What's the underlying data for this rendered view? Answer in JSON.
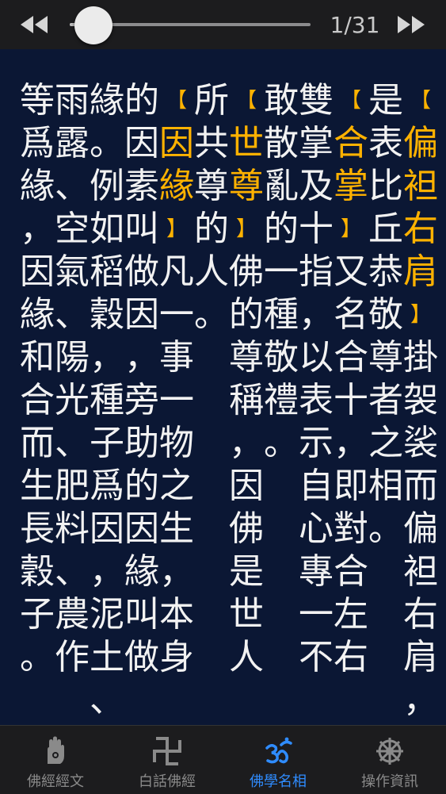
{
  "player": {
    "page_indicator": "1/31",
    "progress": 0.1
  },
  "content": {
    "columns": [
      {
        "chars": [
          "【",
          "偏",
          "袒",
          "右",
          "肩",
          "】",
          "掛",
          "袈",
          "裟",
          "而",
          "偏",
          "袒",
          "右",
          "肩",
          "，"
        ],
        "hl": [
          0,
          1,
          2,
          3,
          4,
          5
        ]
      },
      {
        "chars": [
          "是",
          "表",
          "比",
          "丘",
          "恭",
          "敬",
          "尊",
          "者",
          "之",
          "相",
          "。"
        ],
        "hl": []
      },
      {
        "chars": [
          "【",
          "合",
          "掌",
          "】",
          "又",
          "名",
          "合",
          "十",
          "，",
          "即",
          "對",
          "合",
          "左",
          "右"
        ],
        "hl": [
          0,
          1,
          2,
          3
        ]
      },
      {
        "chars": [
          "雙",
          "掌",
          "及",
          "十",
          "指",
          "，",
          "以",
          "表",
          "示",
          "自",
          "心",
          "專",
          "一",
          "不"
        ],
        "hl": []
      },
      {
        "chars": [
          "敢",
          "散",
          "亂",
          "的",
          "一",
          "種",
          "敬",
          "禮",
          "。"
        ],
        "hl": []
      },
      {
        "chars": [
          "【",
          "世",
          "尊",
          "】",
          "佛",
          "的",
          "尊",
          "稱",
          "，",
          "因",
          "佛",
          "是",
          "世",
          "人"
        ],
        "hl": [
          0,
          1,
          2,
          3
        ]
      },
      {
        "chars": [
          "所",
          "共",
          "尊",
          "的",
          "人",
          "。"
        ],
        "hl": []
      },
      {
        "chars": [
          "【",
          "因",
          "緣",
          "】",
          "凡",
          "一",
          "事",
          "一",
          "物",
          "之",
          "生",
          "，",
          "本",
          "身"
        ],
        "hl": [
          0,
          1,
          2,
          3
        ]
      },
      {
        "chars": [
          "的",
          "因",
          "素",
          "叫",
          "做",
          "因",
          "，",
          "旁",
          "助",
          "的",
          "因",
          "緣",
          "叫",
          "做"
        ],
        "hl": []
      },
      {
        "chars": [
          "緣",
          "。",
          "例",
          "如",
          "稻",
          "穀",
          "，",
          "種",
          "子",
          "爲",
          "因",
          "，",
          "泥",
          "土",
          "、"
        ],
        "hl": []
      },
      {
        "chars": [
          "雨",
          "露",
          "、",
          "空",
          "氣",
          "、",
          "陽",
          "光",
          "、",
          "肥",
          "料",
          "、",
          "農",
          "作"
        ],
        "hl": []
      },
      {
        "chars": [
          "等",
          "爲",
          "緣",
          "，",
          "因",
          "緣",
          "和",
          "合",
          "而",
          "生",
          "長",
          "穀",
          "子",
          "。"
        ],
        "hl": []
      }
    ]
  },
  "tabs": [
    {
      "label": "佛經經文",
      "icon": "hand-icon"
    },
    {
      "label": "白話佛經",
      "icon": "swastika-icon"
    },
    {
      "label": "佛學名相",
      "icon": "om-icon",
      "active": true
    },
    {
      "label": "操作資訊",
      "icon": "dharma-wheel-icon"
    }
  ],
  "colors": {
    "background": "#0b1734",
    "highlight": "#ffb200",
    "active_tab": "#2f8cff",
    "inactive_tab": "#8a8a8a"
  }
}
